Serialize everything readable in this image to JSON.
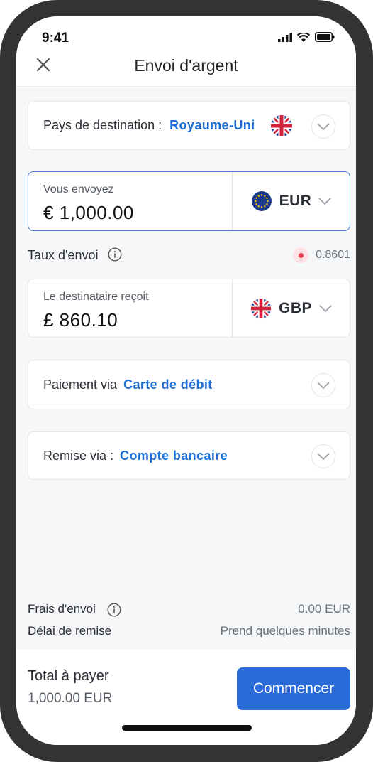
{
  "status_bar": {
    "time": "9:41"
  },
  "header": {
    "title": "Envoi d'argent"
  },
  "destination": {
    "label": "Pays de destination :",
    "value": "Royaume-Uni",
    "flag": "uk-flag-icon"
  },
  "send": {
    "caption": "Vous envoyez",
    "amount": "€ 1,000.00",
    "currency": "EUR",
    "flag": "eu-flag-icon"
  },
  "rate": {
    "label": "Taux d'envoi",
    "value": "0.8601"
  },
  "receive": {
    "caption": "Le destinataire reçoit",
    "amount": "£ 860.10",
    "currency": "GBP",
    "flag": "uk-flag-icon"
  },
  "payment": {
    "label": "Paiement via",
    "value": "Carte de débit"
  },
  "delivery": {
    "label": "Remise via :",
    "value": "Compte bancaire"
  },
  "fees": {
    "label": "Frais d'envoi",
    "value": "0.00 EUR"
  },
  "delay": {
    "label": "Délai de remise",
    "value": "Prend quelques minutes"
  },
  "footer": {
    "total_label": "Total à payer",
    "total_value": "1,000.00 EUR",
    "cta": "Commencer"
  },
  "colors": {
    "accent": "#2a6bd7",
    "link": "#1f6fd6",
    "rate_dot": "#e8455a"
  }
}
